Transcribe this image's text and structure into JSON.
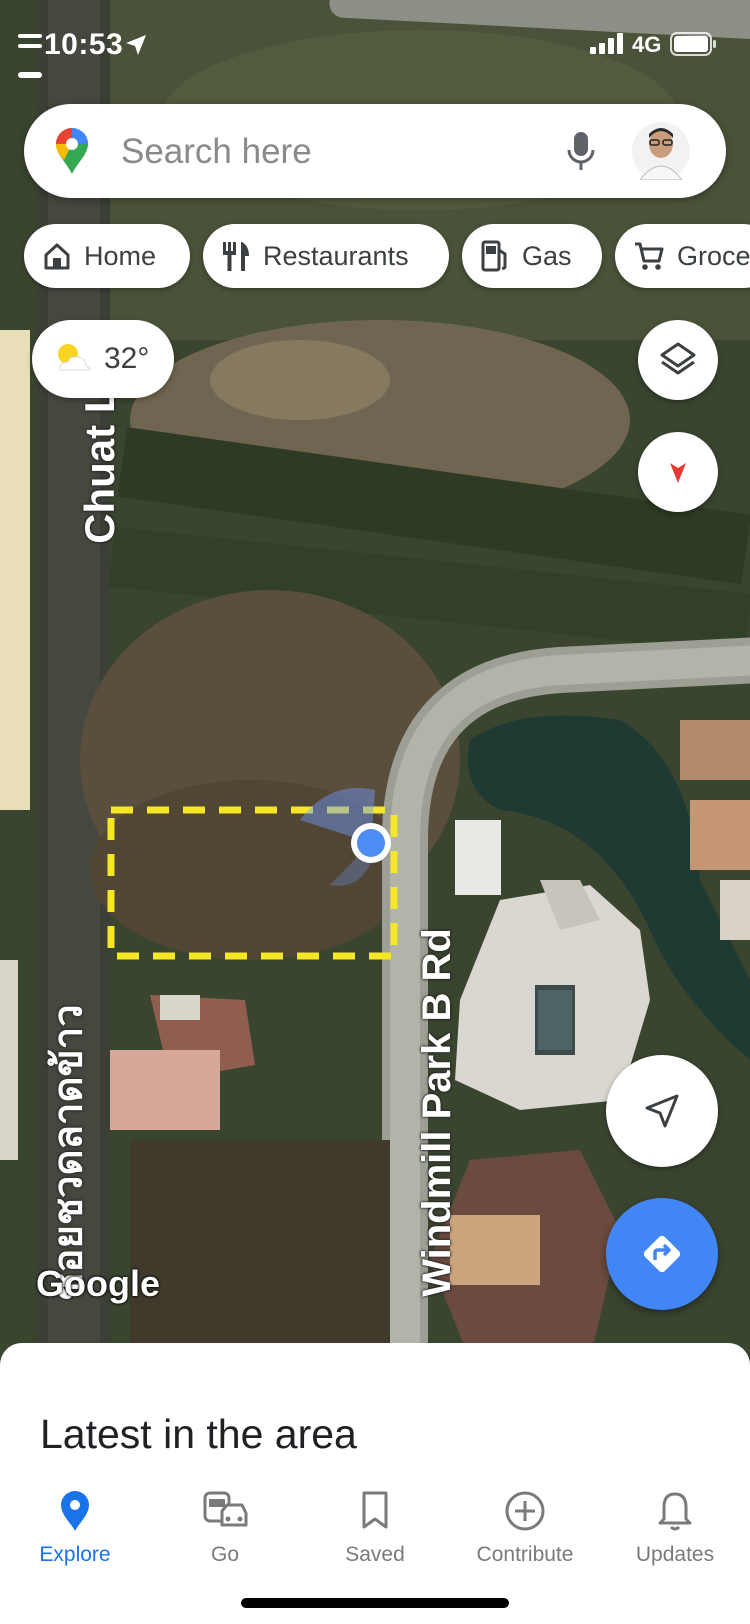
{
  "status": {
    "time": "10:53",
    "network": "4G"
  },
  "search": {
    "placeholder": "Search here"
  },
  "chips": [
    {
      "label": "Home",
      "icon": "home-icon"
    },
    {
      "label": "Restaurants",
      "icon": "restaurant-icon"
    },
    {
      "label": "Gas",
      "icon": "gas-station-icon"
    },
    {
      "label": "Groce",
      "icon": "cart-icon"
    }
  ],
  "weather": {
    "temp": "32°",
    "icon": "sun-cloud-icon"
  },
  "map": {
    "roads": {
      "chuat": "Chuat La",
      "thai": "ซอยชวดลาดข้าว",
      "windmill": "Windmill Park B Rd"
    },
    "attribution": "Google",
    "colors": {
      "selection": "#f5e728",
      "location_dot": "#4c8df6"
    }
  },
  "sheet": {
    "title": "Latest in the area"
  },
  "tabs": [
    {
      "label": "Explore",
      "icon": "explore-pin-icon",
      "active": true
    },
    {
      "label": "Go",
      "icon": "commute-icon",
      "active": false
    },
    {
      "label": "Saved",
      "icon": "bookmark-icon",
      "active": false
    },
    {
      "label": "Contribute",
      "icon": "add-circle-icon",
      "active": false
    },
    {
      "label": "Updates",
      "icon": "bell-icon",
      "active": false
    }
  ],
  "accent": "#1a73e8"
}
